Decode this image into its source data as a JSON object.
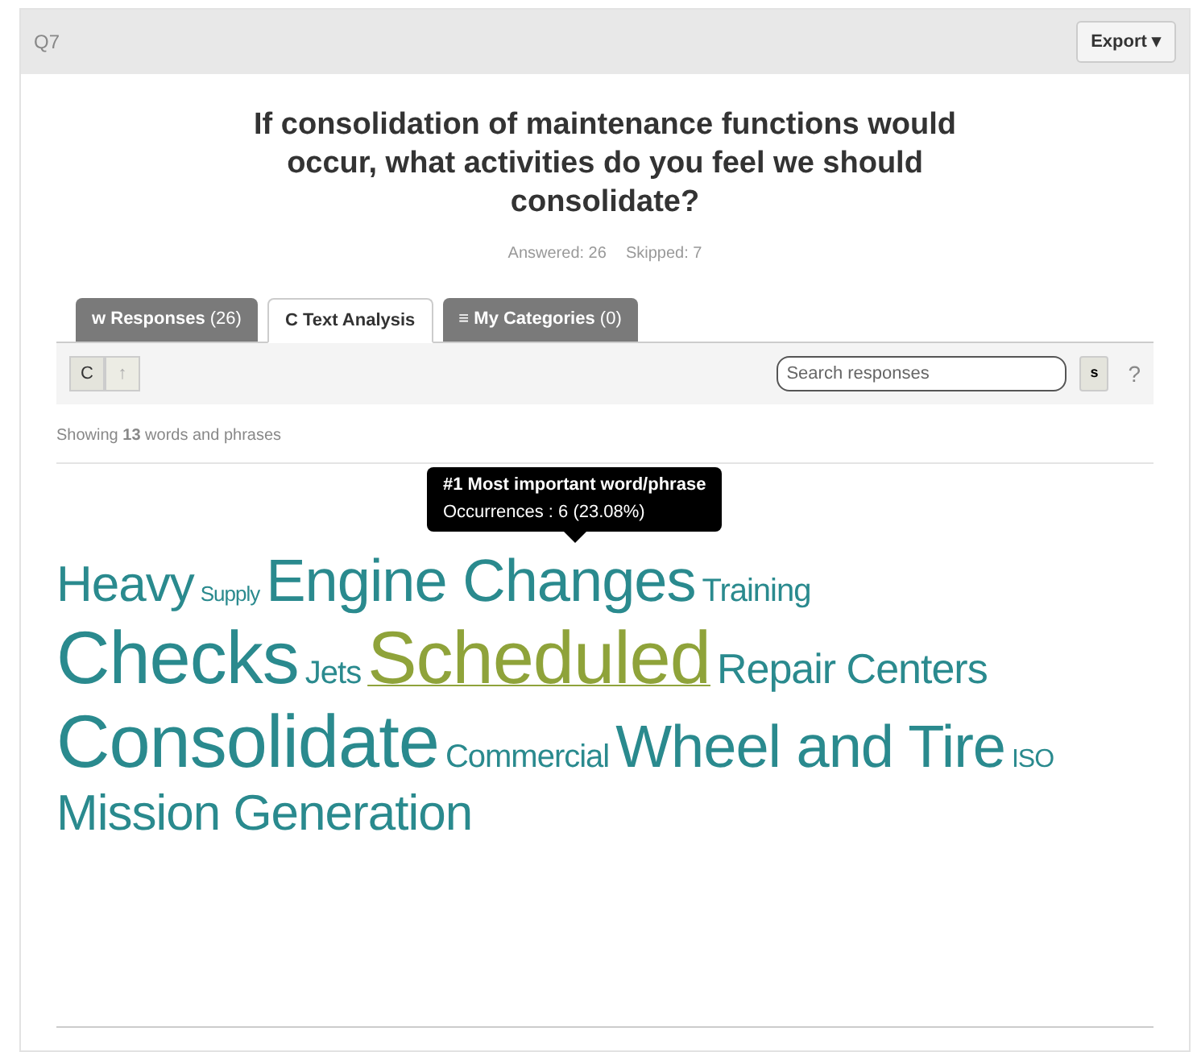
{
  "header": {
    "label": "Q7",
    "export_button": "Export ▾"
  },
  "question": "If consolidation of maintenance functions would occur, what activities do you feel we should consolidate?",
  "stats": [
    "Answered: 26",
    "Skipped: 7"
  ],
  "tabs": [
    {
      "icon": "w",
      "label": "Responses",
      "count": "(26)",
      "selected": false
    },
    {
      "icon": "C",
      "label": "Text Analysis",
      "selected": true
    },
    {
      "icon": "≡",
      "label": "My Categories",
      "count": "(0)",
      "selected": false
    }
  ],
  "toolbar": {
    "view_buttons": [
      {
        "label": "C",
        "selected": true
      },
      {
        "label": "↑",
        "selected": false
      }
    ],
    "search": {
      "placeholder": "Search responses"
    },
    "search_button": "s",
    "help": "?"
  },
  "summary": "Showing **13** words and phrases",
  "tooltip": {
    "title": "#1 Most important word/phrase",
    "detail": "Occurrences : 6 (23.08%)"
  },
  "cloud_rows": [
    {
      "words": [
        {
          "text": "Heavy",
          "kind": "medium",
          "color": "#2a8a8e",
          "selected": false
        },
        {
          "text": "Supply",
          "kind": "mini",
          "color": "#2a8a8e",
          "selected": false
        },
        {
          "text": "Engine Changes",
          "kind": "large",
          "color": "#2a8a8e",
          "selected": false
        },
        {
          "text": "Training",
          "kind": "small",
          "color": "#2a8a8e",
          "selected": false
        }
      ]
    },
    {
      "words": [
        {
          "text": "Checks",
          "kind": "huge",
          "color": "#2a8a8e",
          "selected": false
        },
        {
          "text": "Jets",
          "kind": "small",
          "color": "#2a8a8e",
          "selected": false
        },
        {
          "text": "Scheduled",
          "kind": "huge",
          "color": "#8fa33a",
          "selected": true
        },
        {
          "text": "Repair Centers",
          "kind": "normal",
          "color": "#2a8a8e",
          "selected": false
        }
      ]
    },
    {
      "words": [
        {
          "text": "Consolidate",
          "kind": "huge",
          "color": "#2a8a8e",
          "selected": false
        },
        {
          "text": "Commercial",
          "kind": "small",
          "color": "#2a8a8e",
          "selected": false
        },
        {
          "text": "Wheel and Tire",
          "kind": "large",
          "color": "#2a8a8e",
          "selected": false
        },
        {
          "text": "ISO",
          "kind": "tiny",
          "color": "#2a8a8e",
          "selected": false
        }
      ]
    },
    {
      "words": [
        {
          "text": "Mission Generation",
          "kind": "medium",
          "color": "#2a8a8e",
          "selected": false
        }
      ]
    }
  ]
}
